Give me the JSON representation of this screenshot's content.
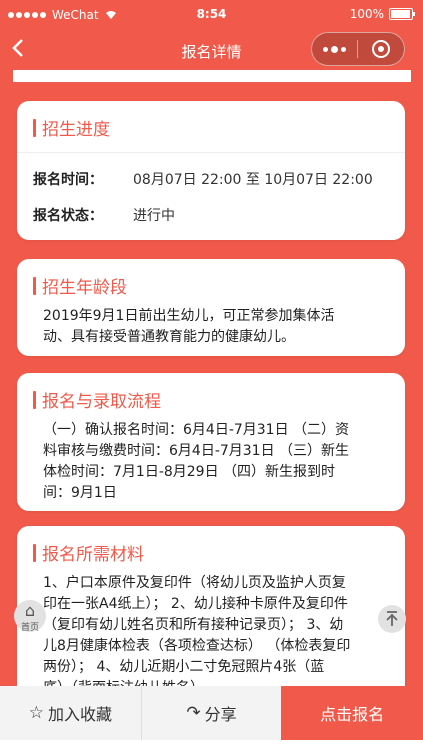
{
  "status_bar": {
    "carrier": "WeChat",
    "time": "8:54",
    "battery": "100%"
  },
  "nav": {
    "title": "报名详情"
  },
  "cards": {
    "progress": {
      "title": "招生进度",
      "time_label": "报名时间：",
      "time_value": "08月07日 22:00 至 10月07日 22:00",
      "status_label": "报名状态：",
      "status_value": "进行中"
    },
    "age": {
      "title": "招生年龄段",
      "lines": [
        "2019年9月1日前出生幼儿，可正常参加集体活",
        "动、具有接受普通教育能力的健康幼儿。"
      ]
    },
    "process": {
      "title": "报名与录取流程",
      "lines": [
        "（一）确认报名时间：6月4日-7月31日 （二）资",
        "料审核与缴费时间：6月4日-7月31日 （三）新生",
        "体检时间：7月1日-8月29日 （四）新生报到时",
        "间：9月1日"
      ]
    },
    "materials": {
      "title": "报名所需材料",
      "lines": [
        "1、户口本原件及复印件（将幼儿页及监护人页复",
        "印在一张A4纸上）； 2、幼儿接种卡原件及复印件",
        "（复印有幼儿姓名页和所有接种记录页）； 3、幼",
        "儿8月健康体检表（各项检查达标） （体检表复印",
        "两份）； 4、幼儿近期小二寸免冠照片4张（蓝",
        "底）（背面标注幼儿姓名）"
      ]
    }
  },
  "floats": {
    "home_label": "首页"
  },
  "bottom_bar": {
    "favorite": "加入收藏",
    "share": "分享",
    "signup": "点击报名"
  },
  "colors": {
    "accent": "#f15a4a"
  }
}
